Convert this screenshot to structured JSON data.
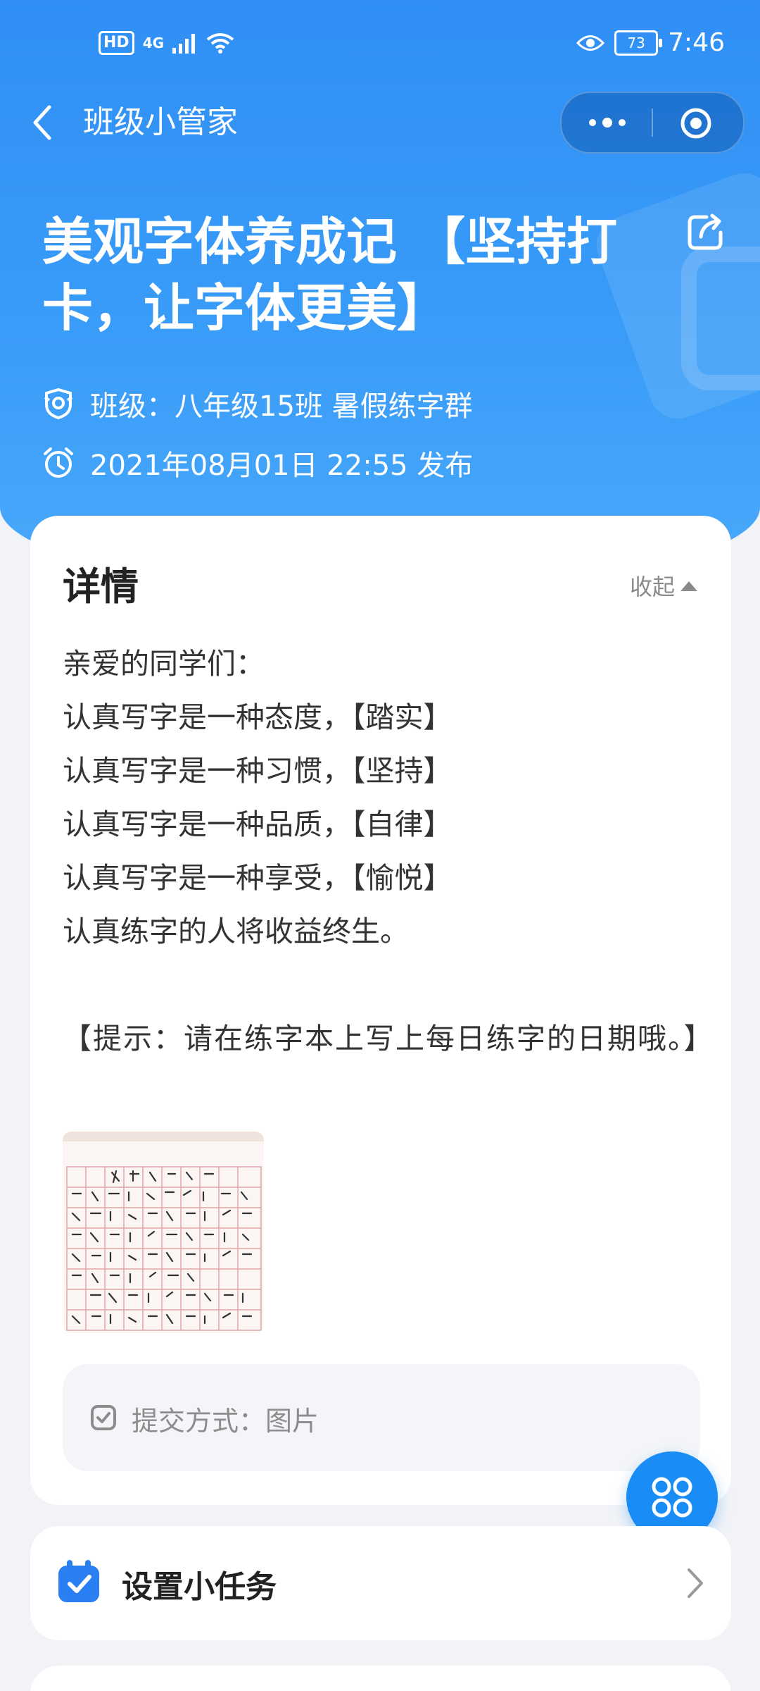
{
  "status_bar": {
    "hd": "HD",
    "signal": "4G",
    "battery": "73",
    "time": "7:46"
  },
  "nav": {
    "title": "班级小管家"
  },
  "header": {
    "title_line1": "美观字体养成记 【坚持打",
    "title_line2": "卡，让字体更美】",
    "class_info": "班级：八年级15班 暑假练字群",
    "publish_info": "2021年08月01日 22:55 发布"
  },
  "detail": {
    "heading": "详情",
    "collapse_label": "收起",
    "lines": [
      "亲爱的同学们：",
      "认真写字是一种态度，【踏实】",
      "认真写字是一种习惯，【坚持】",
      "认真写字是一种品质，【自律】",
      "认真写字是一种享受，【愉悦】",
      "认真练字的人将收益终生。",
      "",
      "【提示：请在练字本上写上每日练字的日期哦。】"
    ],
    "submit_method": "提交方式：图片"
  },
  "task": {
    "label": "设置小任务"
  },
  "colors": {
    "primary_blue": "#2f8ff5",
    "fab_blue": "#1a8cf5",
    "calendar_blue": "#2a7ff3"
  }
}
